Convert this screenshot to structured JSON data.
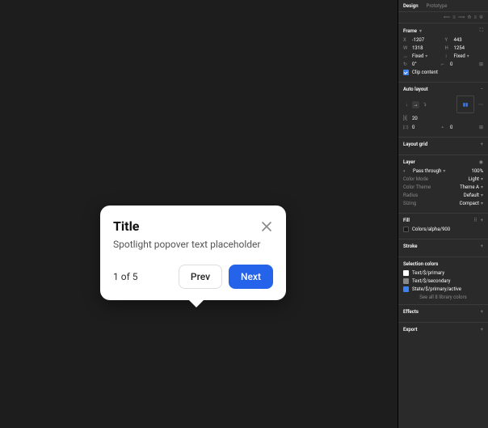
{
  "tabs": {
    "design": "Design",
    "prototype": "Prototype"
  },
  "popover": {
    "title": "Title",
    "body": "Spotlight popover text placeholder",
    "step": "1 of 5",
    "prev": "Prev",
    "next": "Next"
  },
  "frame": {
    "title": "Frame",
    "x_label": "X",
    "x": "-1207",
    "y_label": "Y",
    "y": "443",
    "w_label": "W",
    "w": "1318",
    "h_label": "H",
    "h": "1254",
    "fixed1": "Fixed",
    "fixed2": "Fixed",
    "rot_label": "↻",
    "rot": "0°",
    "cr_label": "⌐",
    "cr": "0",
    "clip": "Clip content"
  },
  "autolayout": {
    "title": "Auto layout",
    "gap_label": "]I[",
    "gap": "20",
    "padh_label": "|□|",
    "padh": "0",
    "padv_label": "⫠",
    "padv": "0"
  },
  "layoutgrid": {
    "title": "Layout grid"
  },
  "layer": {
    "title": "Layer",
    "blend": "Pass through",
    "opacity": "100%",
    "colormode_k": "Color Mode",
    "colormode_v": "Light",
    "colortheme_k": "Color Theme",
    "colortheme_v": "Theme A",
    "radius_k": "Radius",
    "radius_v": "Default",
    "sizing_k": "Sizing",
    "sizing_v": "Compact"
  },
  "fill": {
    "title": "Fill",
    "swatch_color": "#1a1a1a",
    "name": "Colors/alpha/900"
  },
  "stroke": {
    "title": "Stroke"
  },
  "selcolors": {
    "title": "Selection colors",
    "c1_color": "#ffffff",
    "c1": "Text/$/primary",
    "c2_color": "#888888",
    "c2": "Text/$/secondary",
    "c3_color": "#3b82f6",
    "c3": "State/$/primary/active",
    "link": "See all 8 library colors"
  },
  "effects": {
    "title": "Effects"
  },
  "export": {
    "title": "Export"
  }
}
